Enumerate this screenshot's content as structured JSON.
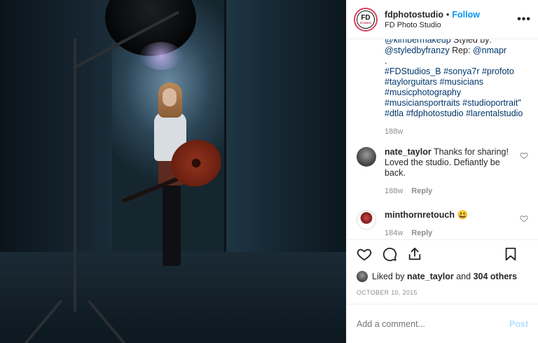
{
  "header": {
    "username": "fdphotostudio",
    "separator": "•",
    "follow_label": "Follow",
    "subtitle": "FD Photo Studio",
    "avatar_text": "FD",
    "avatar_subtext": "STUDIO",
    "more_label": "•••"
  },
  "caption": {
    "line1_plain1": "@kimbermakeup",
    "line1_text": " Styled by: ",
    "line2_mention1": "@styledbyfranzy",
    "line2_text": " Rep: ",
    "line2_mention2": "@nmapr",
    "dot": ".",
    "hashtags_line1": "#FDStudios_B #sonya7r #profoto",
    "hashtags_line2": "#taylorguitars #musicians",
    "hashtags_line3": "#musicphotography",
    "hashtags_line4": "#musiciansportraits #studioportrait\"",
    "hashtags_line5": "#dtla #fdphotostudio #larentalstudio",
    "time": "188w"
  },
  "comments": [
    {
      "username": "nate_taylor",
      "text": "Thanks for sharing! Loved the studio. Defiantly be back.",
      "time": "188w",
      "reply": "Reply"
    },
    {
      "username": "minthornretouch",
      "text": "😃",
      "time": "184w",
      "reply": "Reply"
    }
  ],
  "likes": {
    "prefix": "Liked by",
    "user": "nate_taylor",
    "and": "and",
    "others": "304 others"
  },
  "date": "OCTOBER 10, 2015",
  "add_comment": {
    "placeholder": "Add a comment...",
    "post_label": "Post"
  },
  "colors": {
    "accent_blue": "#0095f6",
    "link_blue": "#00376b",
    "muted_gray": "#8e8e8e",
    "post_disabled": "#b2dffc"
  }
}
